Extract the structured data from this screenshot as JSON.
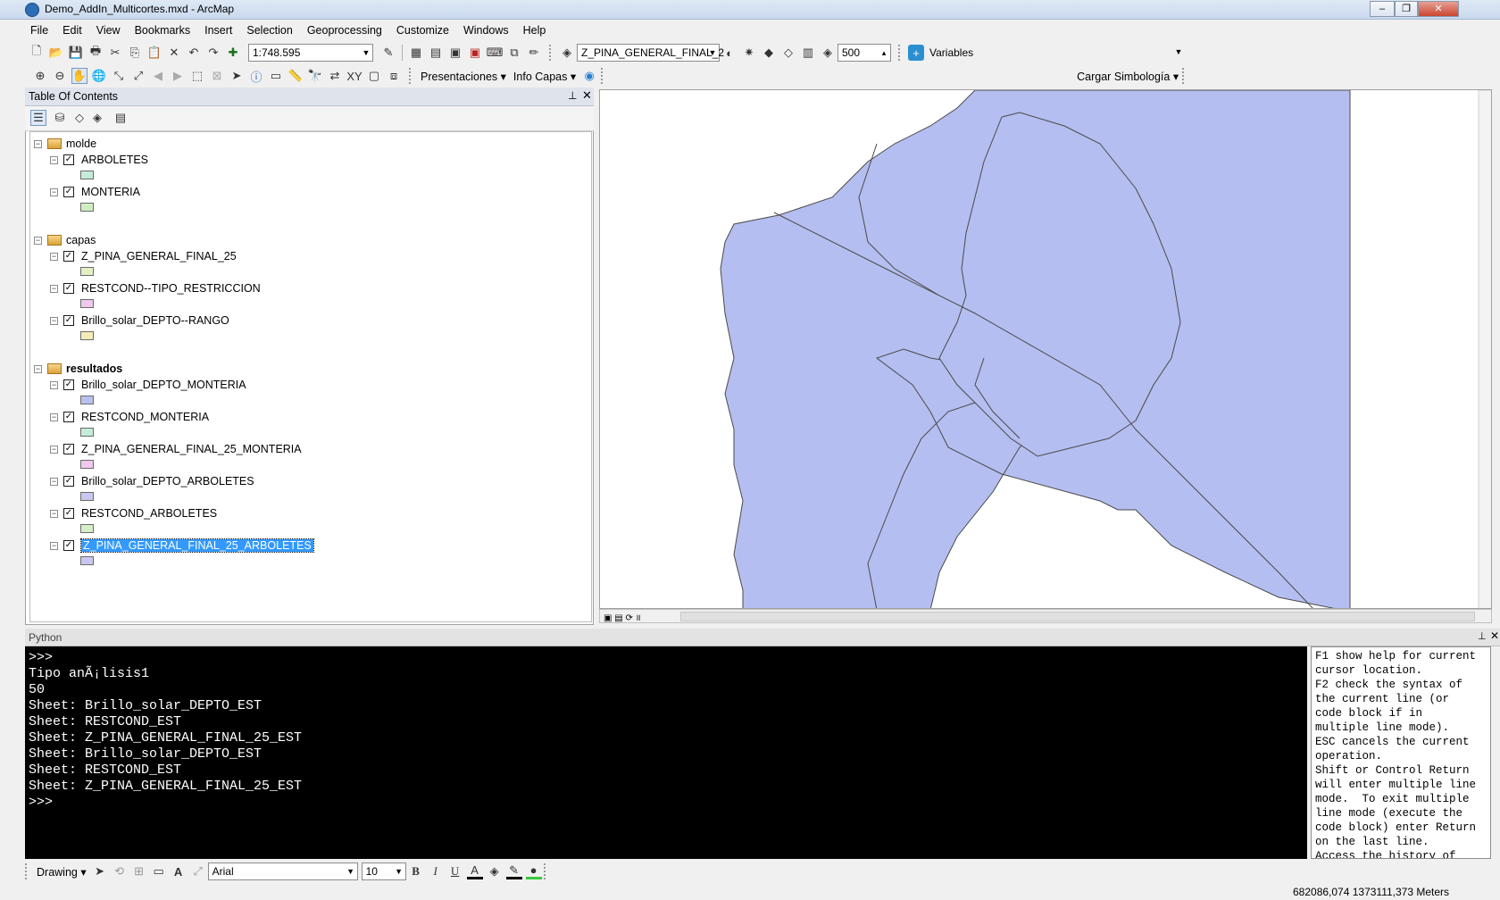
{
  "window": {
    "title": "Demo_AddIn_Multicortes.mxd - ArcMap"
  },
  "menu": [
    "File",
    "Edit",
    "View",
    "Bookmarks",
    "Insert",
    "Selection",
    "Geoprocessing",
    "Customize",
    "Windows",
    "Help"
  ],
  "toolbar1": {
    "scale": "1:748.595",
    "layer_combo": "Z_PINA_GENERAL_FINAL_2",
    "value_500": "500",
    "variables": "Variables"
  },
  "toolbar2": {
    "presentaciones": "Presentaciones",
    "info_capas": "Info Capas",
    "cargar": "Cargar Simbología"
  },
  "toc": {
    "title": "Table Of Contents",
    "groups": [
      {
        "name": "molde",
        "layers": [
          {
            "name": "ARBOLETES",
            "color": "#c4ecd9"
          },
          {
            "name": "MONTERIA",
            "color": "#cfeec0"
          }
        ]
      },
      {
        "name": "capas",
        "layers": [
          {
            "name": "Z_PINA_GENERAL_FINAL_25",
            "color": "#e4f0c4"
          },
          {
            "name": "RESTCOND--TIPO_RESTRICCION",
            "color": "#f0c8ee"
          },
          {
            "name": "Brillo_solar_DEPTO--RANGO",
            "color": "#f4ecb8"
          }
        ]
      },
      {
        "name": "resultados",
        "layers": [
          {
            "name": "Brillo_solar_DEPTO_MONTERIA",
            "color": "#b9c1f0"
          },
          {
            "name": "RESTCOND_MONTERIA",
            "color": "#c4ecd9"
          },
          {
            "name": "Z_PINA_GENERAL_FINAL_25_MONTERIA",
            "color": "#f0c8ee"
          },
          {
            "name": "Brillo_solar_DEPTO_ARBOLETES",
            "color": "#c9c6ef"
          },
          {
            "name": "RESTCOND_ARBOLETES",
            "color": "#d4efc8"
          },
          {
            "name": "Z_PINA_GENERAL_FINAL_25_ARBOLETES",
            "color": "#c9c6ef"
          }
        ]
      }
    ]
  },
  "map": {
    "fill": "#b5bef0",
    "stroke": "#4a4a4a"
  },
  "python": {
    "title": "Python",
    "lines": [
      ">>>",
      "Tipo anÃ¡lisis1",
      "50",
      "Sheet: Brillo_solar_DEPTO_EST",
      "Sheet: RESTCOND_EST",
      "Sheet: Z_PINA_GENERAL_FINAL_25_EST",
      "Sheet: Brillo_solar_DEPTO_EST",
      "Sheet: RESTCOND_EST",
      "Sheet: Z_PINA_GENERAL_FINAL_25_EST",
      ">>>"
    ],
    "help": [
      "F1 show help for current",
      "cursor location.",
      "F2 check the syntax of",
      "the current line (or",
      "code block if in",
      "multiple line mode).",
      "ESC cancels the current",
      "operation.",
      "Shift or Control Return",
      "will enter multiple line",
      "mode.  To exit multiple",
      "line mode (execute the",
      "code block) enter Return",
      "on the last line.",
      "Access the history of"
    ]
  },
  "drawing": {
    "label": "Drawing",
    "font": "Arial",
    "size": "10",
    "bold": "B",
    "italic": "I",
    "underline": "U"
  },
  "status": {
    "coords": "682086,074  1373111,373 Meters"
  }
}
